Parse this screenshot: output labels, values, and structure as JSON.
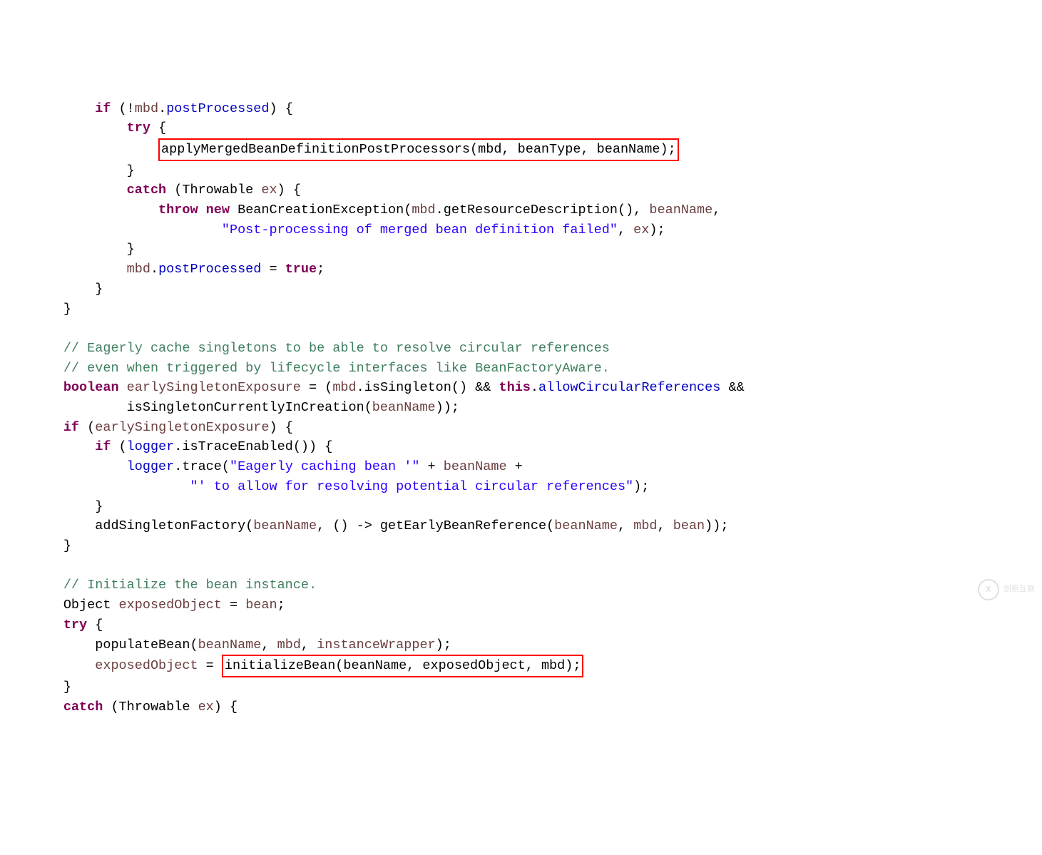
{
  "code": {
    "l1_indent": "            ",
    "l1_if": "if",
    "l1_a": " (!",
    "l1_mbd": "mbd",
    "l1_b": ".",
    "l1_post": "postProcessed",
    "l1_c": ") {",
    "l2_indent": "                ",
    "l2_try": "try",
    "l2_a": " {",
    "l3_indent": "                    ",
    "l3_box": "applyMergedBeanDefinitionPostProcessors(mbd, beanType, beanName);",
    "l4_indent": "                ",
    "l4_a": "}",
    "l5_indent": "                ",
    "l5_catch": "catch",
    "l5_a": " (Throwable ",
    "l5_ex": "ex",
    "l5_b": ") {",
    "l6_indent": "                    ",
    "l6_throw": "throw",
    "l6_sp": " ",
    "l6_new": "new",
    "l6_a": " BeanCreationException(",
    "l6_mbd": "mbd",
    "l6_b": ".getResourceDescription(), ",
    "l6_bn": "beanName",
    "l6_c": ",",
    "l7_indent": "                            ",
    "l7_str": "\"Post-processing of merged bean definition failed\"",
    "l7_a": ", ",
    "l7_ex": "ex",
    "l7_b": ");",
    "l8_indent": "                ",
    "l8_a": "}",
    "l9_indent": "                ",
    "l9_mbd": "mbd",
    "l9_a": ".",
    "l9_post": "postProcessed",
    "l9_b": " = ",
    "l9_true": "true",
    "l9_c": ";",
    "l10_indent": "            ",
    "l10_a": "}",
    "l11_indent": "        ",
    "l11_a": "}",
    "l12": "",
    "l13_indent": "        ",
    "l13_c": "// Eagerly cache singletons to be able to resolve circular references",
    "l14_indent": "        ",
    "l14_c": "// even when triggered by lifecycle interfaces like BeanFactoryAware.",
    "l15_indent": "        ",
    "l15_bool": "boolean",
    "l15_sp": " ",
    "l15_es": "earlySingletonExposure",
    "l15_a": " = (",
    "l15_mbd": "mbd",
    "l15_b": ".isSingleton() && ",
    "l15_this": "this",
    "l15_c": ".",
    "l15_acr": "allowCircularReferences",
    "l15_d": " &&",
    "l16_indent": "                ",
    "l16_a": "isSingletonCurrentlyInCreation(",
    "l16_bn": "beanName",
    "l16_b": "));",
    "l17_indent": "        ",
    "l17_if": "if",
    "l17_a": " (",
    "l17_es": "earlySingletonExposure",
    "l17_b": ") {",
    "l18_indent": "            ",
    "l18_if": "if",
    "l18_a": " (",
    "l18_logger": "logger",
    "l18_b": ".isTraceEnabled()) {",
    "l19_indent": "                ",
    "l19_logger": "logger",
    "l19_a": ".trace(",
    "l19_str": "\"Eagerly caching bean '\"",
    "l19_b": " + ",
    "l19_bn": "beanName",
    "l19_c": " +",
    "l20_indent": "                        ",
    "l20_str": "\"' to allow for resolving potential circular references\"",
    "l20_a": ");",
    "l21_indent": "            ",
    "l21_a": "}",
    "l22_indent": "            ",
    "l22_a": "addSingletonFactory(",
    "l22_bn": "beanName",
    "l22_b": ", () -> getEarlyBeanReference(",
    "l22_bn2": "beanName",
    "l22_c": ", ",
    "l22_mbd": "mbd",
    "l22_d": ", ",
    "l22_bean": "bean",
    "l22_e": "));",
    "l23_indent": "        ",
    "l23_a": "}",
    "l24": "",
    "l25_indent": "        ",
    "l25_c": "// Initialize the bean instance.",
    "l26_indent": "        ",
    "l26_a": "Object ",
    "l26_eo": "exposedObject",
    "l26_b": " = ",
    "l26_bean": "bean",
    "l26_c": ";",
    "l27_indent": "        ",
    "l27_try": "try",
    "l27_a": " {",
    "l28_indent": "            ",
    "l28_a": "populateBean(",
    "l28_bn": "beanName",
    "l28_b": ", ",
    "l28_mbd": "mbd",
    "l28_c": ", ",
    "l28_iw": "instanceWrapper",
    "l28_d": ");",
    "l29_indent": "            ",
    "l29_eo": "exposedObject",
    "l29_a": " = ",
    "l29_box": "initializeBean(beanName, exposedObject, mbd);",
    "l30_indent": "        ",
    "l30_a": "}",
    "l31_indent": "        ",
    "l31_catch": "catch",
    "l31_a": " (Throwable ",
    "l31_ex": "ex",
    "l31_b": ") {"
  },
  "watermark": {
    "text": "创新互联",
    "logo": "☓"
  }
}
